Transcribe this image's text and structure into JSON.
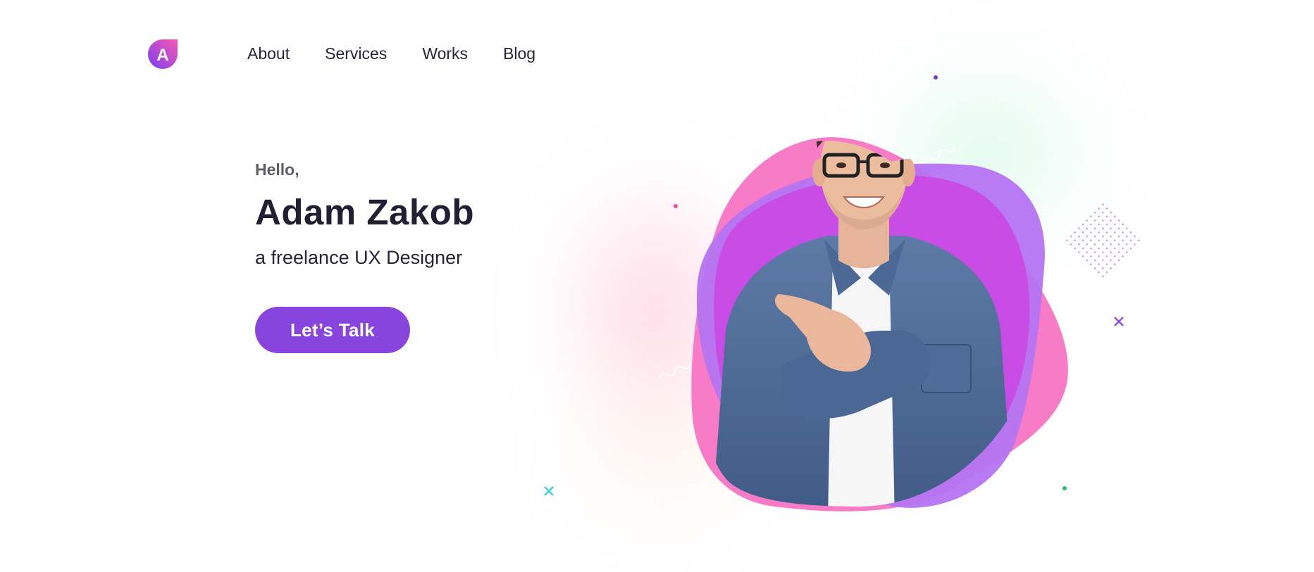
{
  "brand": {
    "logo_letter": "A",
    "logo_icon": "letter-a-logo-icon",
    "accent": "#8745de",
    "pink": "#f77bc6",
    "magenta": "#c94ce6"
  },
  "nav": {
    "items": [
      {
        "label": "About"
      },
      {
        "label": "Services"
      },
      {
        "label": "Works"
      },
      {
        "label": "Blog"
      }
    ]
  },
  "hero": {
    "greeting": "Hello,",
    "name": "Adam Zakob",
    "subtitle": "a freelance UX Designer",
    "cta_label": "Let’s Talk"
  },
  "illustration": {
    "subject": "portrait-photo",
    "decorations": [
      "dot-pattern-diamond",
      "squiggle-line",
      "cross-mark",
      "dot"
    ]
  }
}
